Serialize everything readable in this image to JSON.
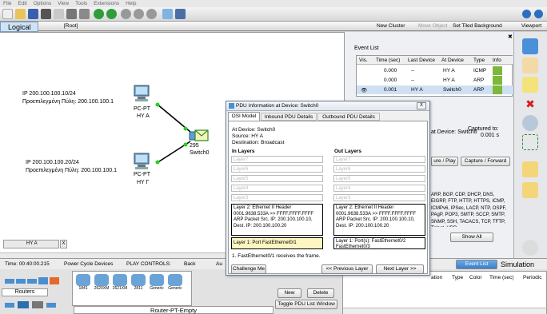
{
  "menu": [
    "File",
    "Edit",
    "Options",
    "View",
    "Tools",
    "Extensions",
    "Help"
  ],
  "workspace": {
    "tab": "Logical",
    "root": "[Root]",
    "new_cluster": "New Cluster",
    "move_object": "Move Object",
    "set_bg": "Set Tiled Background",
    "viewport": "Viewport"
  },
  "network": {
    "pc1": {
      "ip": "IP 200.100.100.10/24",
      "gw": "Προεπιλεγμένη Πύλη: 200.100.100.1",
      "type": "PC-PT",
      "name": "HY A"
    },
    "pc2": {
      "ip": "IP 200.100.100.20/24",
      "gw": "Προεπιλεγμένη Πύλη: 200.100.100.1",
      "type": "PC-PT",
      "name": "HY Γ"
    },
    "switch": {
      "model": "295",
      "name": "Switch0"
    },
    "tab_label": "HY A",
    "tab_close": "X"
  },
  "event_list": {
    "title": "Event List",
    "headers": [
      "Vis.",
      "Time (sec)",
      "Last Device",
      "At Device",
      "Type",
      "Info"
    ],
    "rows": [
      {
        "vis": "",
        "time": "0.000",
        "last": "--",
        "at": "HY A",
        "type": "ICMP",
        "color": "#7db83a"
      },
      {
        "vis": "",
        "time": "0.000",
        "last": "--",
        "at": "HY A",
        "type": "ARP",
        "color": "#7db83a"
      },
      {
        "vis": "eye",
        "time": "0.001",
        "last": "HY A",
        "at": "Switch0",
        "type": "ARP",
        "color": "#7db83a"
      }
    ],
    "at_device": "at Device: Switch0",
    "captured_to": "Captured to:",
    "captured_value": "0.001 s",
    "capture_play": "ure / Play",
    "capture_forward": "Capture / Forward",
    "protocols": "ARP, BGP, CDP, DHCP, DNS, EIGRP, FTP, HTTP, HTTPS, ICMP, ICMPv6, IPSec, LACP, NTP, OSPF, PAgP, POP3, SMTP, SCCP, SMTP, SNMP, SSH, TACACS, TCP, TFTP, Telnet, UDP,",
    "show_all": "Show All"
  },
  "dialog": {
    "title": "PDU Information at Device: Switch0",
    "close": "X",
    "tabs": [
      "OSI Model",
      "Inbound PDU Details",
      "Outbound PDU Details"
    ],
    "at_device": "At Device: Switch0",
    "source": "Source: HY A",
    "destination": "Destination: Broadcast",
    "in_title": "In Layers",
    "out_title": "Out Layers",
    "in_empty": [
      "Layer7",
      "Layer6",
      "Layer5",
      "Layer4",
      "Layer3"
    ],
    "out_empty": [
      "Layer7",
      "Layer6",
      "Layer5",
      "Layer4",
      "Layer3"
    ],
    "in_l2": "Layer 2: Ethernet II Header 0001.9638.533A >> FFFF.FFFF.FFFF ARP Packet Src. IP: 200.100.100.10, Dest. IP: 200.100.100.20",
    "out_l2": "Layer 2: Ethernet II Header 0001.9638.533A >> FFFF.FFFF.FFFF ARP Packet Src. IP: 200.100.100.10, Dest. IP: 200.100.100.20",
    "in_l1": "Layer 1: Port FastEthernet0/1",
    "out_l1": "Layer 1: Port(s): FastEthernet0/2 FastEthernet0/3",
    "desc": "1. FastEthernet0/1 receives the frame.",
    "challenge": "Challenge Me",
    "prev": "<< Previous Layer",
    "next": "Next Layer >>"
  },
  "status": {
    "time": "Time: 00:40:00.215",
    "power": "Power Cycle Devices",
    "play": "PLAY CONTROLS:",
    "back": "Back",
    "au": "Au",
    "event_list_btn": "Event List",
    "simulation": "Simulation"
  },
  "bottom": {
    "category": "Routers",
    "devices": [
      "1841",
      "2620XM",
      "2621XM",
      "2811",
      "Generic",
      "Generic"
    ],
    "selected": "Router-PT-Empty",
    "new_btn": "New",
    "delete_btn": "Delete",
    "toggle": "Toggle PDU List Window",
    "pdu_headers": [
      "ation",
      "Type",
      "Color",
      "Time (sec)",
      "Periodic"
    ]
  }
}
